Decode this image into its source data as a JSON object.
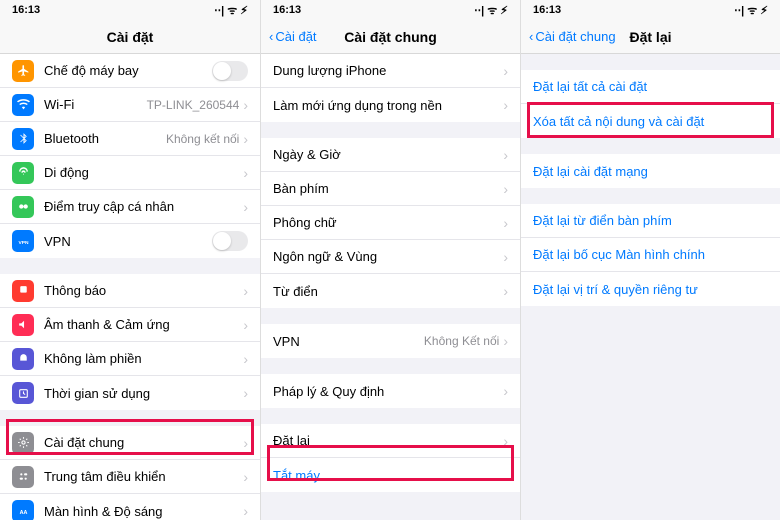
{
  "status": {
    "time": "16:13",
    "signal": "⋅⋅|",
    "wifi": "ᯤ",
    "battery": "⚡︎"
  },
  "p1": {
    "title": "Cài đặt",
    "rows": {
      "airplane": {
        "label": "Chế độ máy bay"
      },
      "wifi": {
        "label": "Wi-Fi",
        "value": "TP-LINK_260544"
      },
      "bt": {
        "label": "Bluetooth",
        "value": "Không kết nối"
      },
      "cell": {
        "label": "Di động"
      },
      "hotspot": {
        "label": "Điểm truy cập cá nhân"
      },
      "vpn": {
        "label": "VPN"
      },
      "notif": {
        "label": "Thông báo"
      },
      "sound": {
        "label": "Âm thanh & Cảm ứng"
      },
      "dnd": {
        "label": "Không làm phiền"
      },
      "screen": {
        "label": "Thời gian sử dụng"
      },
      "general": {
        "label": "Cài đặt chung"
      },
      "cc": {
        "label": "Trung tâm điều khiển"
      },
      "display": {
        "label": "Màn hình & Độ sáng"
      }
    }
  },
  "p2": {
    "back": "Cài đặt",
    "title": "Cài đặt chung",
    "rows": {
      "storage": {
        "label": "Dung lượng iPhone"
      },
      "bgrefresh": {
        "label": "Làm mới ứng dụng trong nền"
      },
      "datetime": {
        "label": "Ngày & Giờ"
      },
      "keyboard": {
        "label": "Bàn phím"
      },
      "fonts": {
        "label": "Phông chữ"
      },
      "lang": {
        "label": "Ngôn ngữ & Vùng"
      },
      "dict": {
        "label": "Từ điển"
      },
      "vpn": {
        "label": "VPN",
        "value": "Không Kết nối"
      },
      "legal": {
        "label": "Pháp lý & Quy định"
      },
      "reset": {
        "label": "Đặt lại"
      },
      "shutdown": {
        "label": "Tắt máy"
      }
    }
  },
  "p3": {
    "back": "Cài đặt chung",
    "title": "Đặt lại",
    "rows": {
      "allsettings": {
        "label": "Đặt lại tất cả cài đặt"
      },
      "erase": {
        "label": "Xóa tất cả nội dung và cài đặt"
      },
      "network": {
        "label": "Đặt lại cài đặt mạng"
      },
      "kbdict": {
        "label": "Đặt lại từ điển bàn phím"
      },
      "home": {
        "label": "Đặt lại bố cục Màn hình chính"
      },
      "privacy": {
        "label": "Đặt lại vị trí & quyền riêng tư"
      }
    }
  }
}
